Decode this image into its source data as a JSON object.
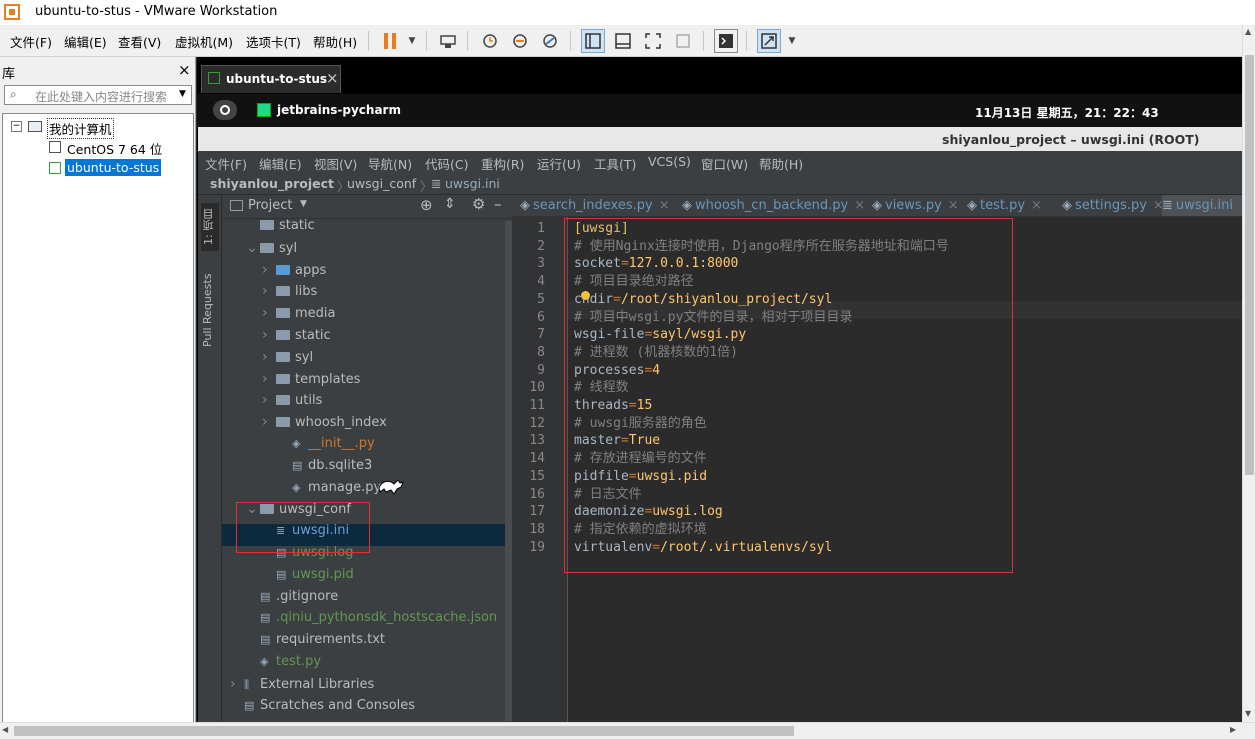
{
  "window": {
    "title": "ubuntu-to-stus - VMware Workstation"
  },
  "vmware_menu": [
    "文件(F)",
    "编辑(E)",
    "查看(V)",
    "虚拟机(M)",
    "选项卡(T)",
    "帮助(H)"
  ],
  "library": {
    "title": "库",
    "close": "×",
    "search_placeholder": "在此处键入内容进行搜索",
    "root": "我的计算机",
    "vms": [
      "CentOS 7 64 位",
      "ubuntu-to-stus"
    ]
  },
  "vm_tab": {
    "label": "ubuntu-to-stus",
    "close": "×"
  },
  "gnome": {
    "app": "jetbrains-pycharm",
    "clock": "11月13日 星期五，21：22：43"
  },
  "pycharm": {
    "title": "shiyanlou_project – uwsgi.ini (ROOT)",
    "menu": [
      "文件(F)",
      "编辑(E)",
      "视图(V)",
      "导航(N)",
      "代码(C)",
      "重构(R)",
      "运行(U)",
      "工具(T)",
      "VCS(S)",
      "窗口(W)",
      "帮助(H)"
    ],
    "breadcrumb": [
      "shiyanlou_project",
      "uwsgi_conf",
      "uwsgi.ini"
    ],
    "side_tabs": [
      "1: 项目",
      "Pull Requests"
    ],
    "project_header": "Project",
    "tree": [
      {
        "name": "static",
        "indent": 1,
        "type": "folder",
        "chev": ""
      },
      {
        "name": "syl",
        "indent": 1,
        "type": "folder",
        "chev": "v"
      },
      {
        "name": "apps",
        "indent": 2,
        "type": "folder-blue",
        "chev": ">"
      },
      {
        "name": "libs",
        "indent": 2,
        "type": "folder",
        "chev": ">"
      },
      {
        "name": "media",
        "indent": 2,
        "type": "folder",
        "chev": ">"
      },
      {
        "name": "static",
        "indent": 2,
        "type": "folder",
        "chev": ">"
      },
      {
        "name": "syl",
        "indent": 2,
        "type": "folder",
        "chev": ">"
      },
      {
        "name": "templates",
        "indent": 2,
        "type": "folder",
        "chev": ">"
      },
      {
        "name": "utils",
        "indent": 2,
        "type": "folder",
        "chev": ">"
      },
      {
        "name": "whoosh_index",
        "indent": 2,
        "type": "folder",
        "chev": ">"
      },
      {
        "name": "__init__.py",
        "indent": 3,
        "type": "py-orange",
        "chev": ""
      },
      {
        "name": "db.sqlite3",
        "indent": 3,
        "type": "file",
        "chev": ""
      },
      {
        "name": "manage.py",
        "indent": 3,
        "type": "py",
        "chev": ""
      },
      {
        "name": "uwsgi_conf",
        "indent": 1,
        "type": "folder",
        "chev": "v"
      },
      {
        "name": "uwsgi.ini",
        "indent": 2,
        "type": "ini-green",
        "chev": ""
      },
      {
        "name": "uwsgi.log",
        "indent": 2,
        "type": "file-green",
        "chev": ""
      },
      {
        "name": "uwsgi.pid",
        "indent": 2,
        "type": "file-green",
        "chev": ""
      },
      {
        "name": ".gitignore",
        "indent": 1,
        "type": "file",
        "chev": ""
      },
      {
        "name": ".qiniu_pythonsdk_hostscache.json",
        "indent": 1,
        "type": "file-green",
        "chev": ""
      },
      {
        "name": "requirements.txt",
        "indent": 1,
        "type": "file",
        "chev": ""
      },
      {
        "name": "test.py",
        "indent": 1,
        "type": "py-green",
        "chev": ""
      },
      {
        "name": "External Libraries",
        "indent": 0,
        "type": "lib",
        "chev": ">"
      },
      {
        "name": "Scratches and Consoles",
        "indent": 0,
        "type": "scratch",
        "chev": ""
      }
    ],
    "tabs": [
      "search_indexes.py",
      "whoosh_cn_backend.py",
      "views.py",
      "test.py",
      "settings.py",
      "uwsgi.ini"
    ],
    "code": [
      [
        {
          "t": "[uwsgi]",
          "c": "sec"
        }
      ],
      [
        {
          "t": "# 使用Nginx连接时使用，Django程序所在服务器地址和端口号",
          "c": "c"
        }
      ],
      [
        {
          "t": "socket",
          "c": "p"
        },
        {
          "t": "=",
          "c": "k"
        },
        {
          "t": "127.0.0.1:8000",
          "c": "s"
        }
      ],
      [
        {
          "t": "# 项目目录绝对路径",
          "c": "c"
        }
      ],
      [
        {
          "t": "chdir",
          "c": "p"
        },
        {
          "t": "=",
          "c": "k"
        },
        {
          "t": "/root/shiyanlou_project/syl",
          "c": "s"
        }
      ],
      [
        {
          "t": "# 项目中wsgi.py文件的目录，相对于项目目录",
          "c": "c"
        }
      ],
      [
        {
          "t": "wsgi-file",
          "c": "p"
        },
        {
          "t": "=",
          "c": "k"
        },
        {
          "t": "sayl/wsgi.py",
          "c": "s"
        }
      ],
      [
        {
          "t": "# 进程数 (机器核数的1倍)",
          "c": "c"
        }
      ],
      [
        {
          "t": "processes",
          "c": "p"
        },
        {
          "t": "=",
          "c": "k"
        },
        {
          "t": "4",
          "c": "s"
        }
      ],
      [
        {
          "t": "# 线程数",
          "c": "c"
        }
      ],
      [
        {
          "t": "threads",
          "c": "p"
        },
        {
          "t": "=",
          "c": "k"
        },
        {
          "t": "15",
          "c": "s"
        }
      ],
      [
        {
          "t": "# uwsgi服务器的角色",
          "c": "c"
        }
      ],
      [
        {
          "t": "master",
          "c": "p"
        },
        {
          "t": "=",
          "c": "k"
        },
        {
          "t": "True",
          "c": "s"
        }
      ],
      [
        {
          "t": "# 存放进程编号的文件",
          "c": "c"
        }
      ],
      [
        {
          "t": "pidfile",
          "c": "p"
        },
        {
          "t": "=",
          "c": "k"
        },
        {
          "t": "uwsgi.pid",
          "c": "s"
        }
      ],
      [
        {
          "t": "# 日志文件",
          "c": "c"
        }
      ],
      [
        {
          "t": "daemonize",
          "c": "p"
        },
        {
          "t": "=",
          "c": "k"
        },
        {
          "t": "uwsgi.log",
          "c": "s"
        }
      ],
      [
        {
          "t": "# 指定依赖的虚拟环境",
          "c": "c"
        }
      ],
      [
        {
          "t": "virtualenv",
          "c": "p"
        },
        {
          "t": "=",
          "c": "k"
        },
        {
          "t": "/root/.virtualenvs/syl",
          "c": "s"
        }
      ]
    ]
  },
  "colors": {
    "accent_red": "#e03030",
    "selection": "#0d293e",
    "vmware_orange": "#e67e22"
  }
}
